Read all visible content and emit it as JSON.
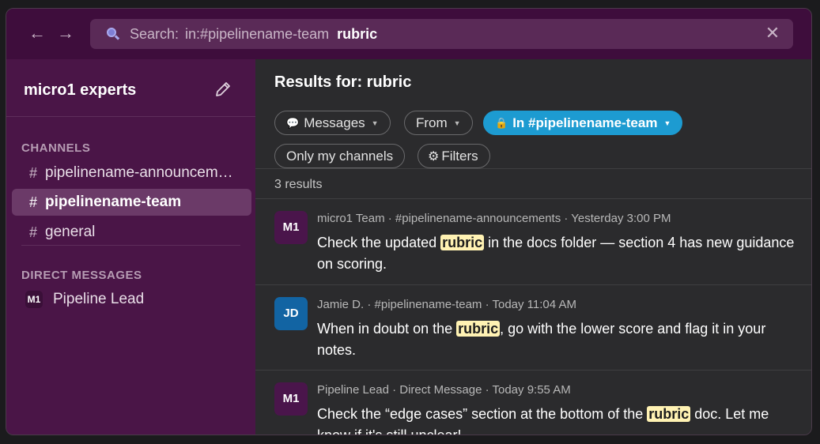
{
  "nav": {
    "back": "←",
    "forward": "→"
  },
  "search": {
    "prefix": "Search:",
    "scope": "in:#pipelinename-team",
    "term": "rubric",
    "clear": "✕"
  },
  "sidebar": {
    "workspace": "micro1 experts",
    "channels_title": "CHANNELS",
    "channels": [
      {
        "label": "pipelinename-announcements",
        "active": false
      },
      {
        "label": "pipelinename-team",
        "active": true
      },
      {
        "label": "general",
        "active": false
      }
    ],
    "dm_title": "DIRECT MESSAGES",
    "dms": [
      {
        "avatar": "M1",
        "label": "Pipeline Lead"
      }
    ]
  },
  "main": {
    "title": "Results for: rubric",
    "filters": {
      "messages": "Messages",
      "from": "From",
      "channel": "In #pipelinename-team",
      "only_my_channels": "Only my channels",
      "filters": "Filters"
    },
    "count": "3 results",
    "results": [
      {
        "avatar": "M1",
        "avatar_color": "#4a154b",
        "meta": "micro1 Team · #pipelinename-announcements · Yesterday 3:00 PM",
        "before": "Check the updated ",
        "highlight": "rubric",
        "after": " in the docs folder — section 4 has new guidance on scoring."
      },
      {
        "avatar": "JD",
        "avatar_color": "#1264a3",
        "meta": "Jamie D. · #pipelinename-team · Today 11:04 AM",
        "before": "When in doubt on the ",
        "highlight": "rubric",
        "after": ", go with the lower score and flag it in your notes."
      },
      {
        "avatar": "M1",
        "avatar_color": "#4a154b",
        "meta": "Pipeline Lead · Direct Message · Today 9:55 AM",
        "before": "Check the “edge cases” section at the bottom of the ",
        "highlight": "rubric",
        "after": " doc. Let me know if it's still unclear!"
      }
    ]
  },
  "icons": {
    "search": "search-icon",
    "compose": "compose-icon",
    "messages": "speech-bubble-icon",
    "channel_lock": "lock-icon",
    "filters": "gear-icon"
  },
  "colors": {
    "topbar": "#3e0d3c",
    "sidebar": "#4a1547",
    "active_item": "#6b3a68",
    "selected_chip": "#1d9bd1",
    "highlight": "#fff2b3"
  }
}
